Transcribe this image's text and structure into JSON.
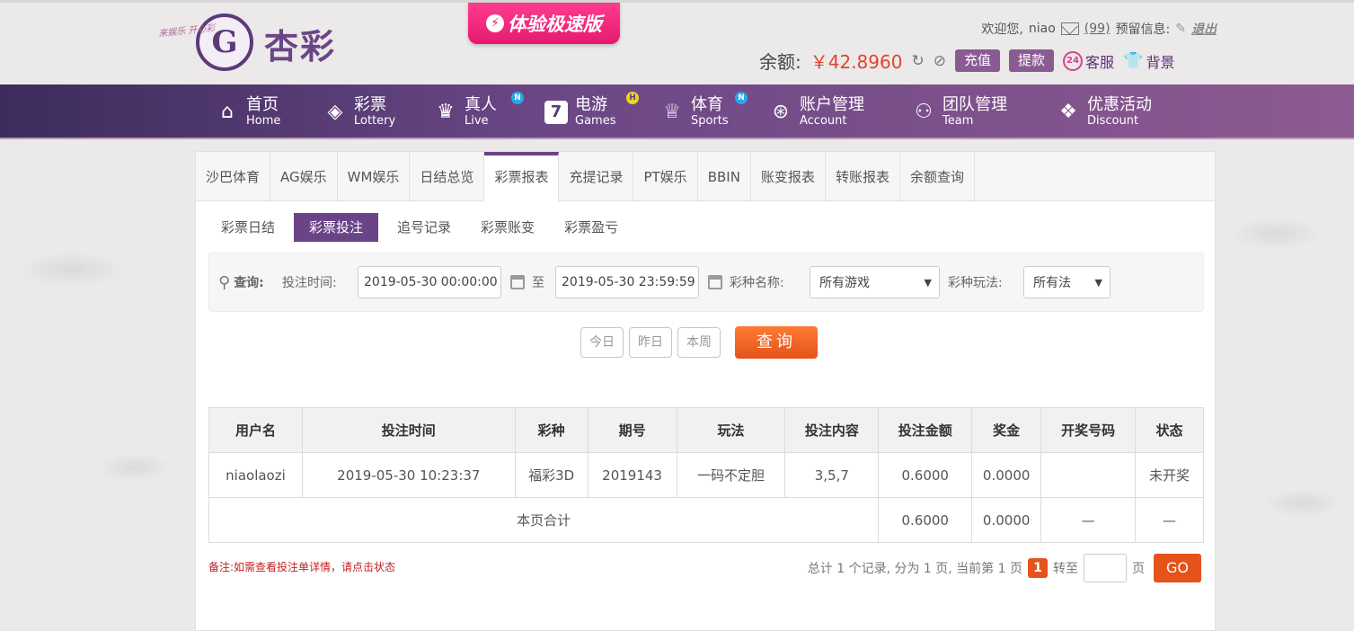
{
  "header": {
    "logo_text": "杏彩",
    "logo_mark": "G",
    "logo_slogan": "来娱乐 开心彩",
    "promo_label": "体验极速版",
    "welcome": "欢迎您,",
    "username": "niao",
    "mail_count": "(99)",
    "reserved_info_label": "预留信息:",
    "logout_label": "退出",
    "balance_label": "余额:",
    "balance_value": "￥42.8960",
    "deposit_label": "充值",
    "withdraw_label": "提款",
    "service_badge": "24",
    "service_label": "客服",
    "background_label": "背景"
  },
  "nav": {
    "items": [
      {
        "cn": "首页",
        "en": "Home"
      },
      {
        "cn": "彩票",
        "en": "Lottery"
      },
      {
        "cn": "真人",
        "en": "Live",
        "badge": "N"
      },
      {
        "cn": "电游",
        "en": "Games",
        "badge": "H",
        "icon_glyph": "7"
      },
      {
        "cn": "体育",
        "en": "Sports",
        "badge": "N"
      },
      {
        "cn": "账户管理",
        "en": "Account"
      },
      {
        "cn": "团队管理",
        "en": "Team"
      },
      {
        "cn": "优惠活动",
        "en": "Discount"
      }
    ]
  },
  "tabs": [
    "沙巴体育",
    "AG娱乐",
    "WM娱乐",
    "日结总览",
    "彩票报表",
    "充提记录",
    "PT娱乐",
    "BBIN",
    "账变报表",
    "转账报表",
    "余额查询"
  ],
  "active_tab": "彩票报表",
  "subtabs": [
    "彩票日结",
    "彩票投注",
    "追号记录",
    "彩票账变",
    "彩票盈亏"
  ],
  "active_subtab": "彩票投注",
  "query": {
    "search_label": "查询:",
    "bet_time_label": "投注时间:",
    "start_time": "2019-05-30 00:00:00",
    "to_label": "至",
    "end_time": "2019-05-30 23:59:59",
    "lottery_name_label": "彩种名称:",
    "lottery_name_value": "所有游戏",
    "play_label": "彩种玩法:",
    "play_value": "所有法",
    "today_label": "今日",
    "yesterday_label": "昨日",
    "week_label": "本周",
    "submit_label": "查询"
  },
  "table": {
    "headers": [
      "用户名",
      "投注时间",
      "彩种",
      "期号",
      "玩法",
      "投注内容",
      "投注金额",
      "奖金",
      "开奖号码",
      "状态"
    ],
    "rows": [
      [
        "niaolaozi",
        "2019-05-30 10:23:37",
        "福彩3D",
        "2019143",
        "一码不定胆",
        "3,5,7",
        "0.6000",
        "0.0000",
        "",
        "未开奖"
      ]
    ],
    "subtotal_label": "本页合计",
    "subtotal_amount": "0.6000",
    "subtotal_bonus": "0.0000",
    "subtotal_dash": "—"
  },
  "footer": {
    "note": "备注:如需查看投注单详情，请点击状态",
    "summary": "总计 1 个记录, 分为 1 页, 当前第 1 页",
    "current_page": "1",
    "goto_label": "转至",
    "page_unit": "页",
    "go_label": "GO"
  },
  "colors": {
    "accent_purple": "#6b4488",
    "orange": "#e4531b",
    "status_green": "#2e8b2e",
    "balance_red": "#e0462e"
  }
}
